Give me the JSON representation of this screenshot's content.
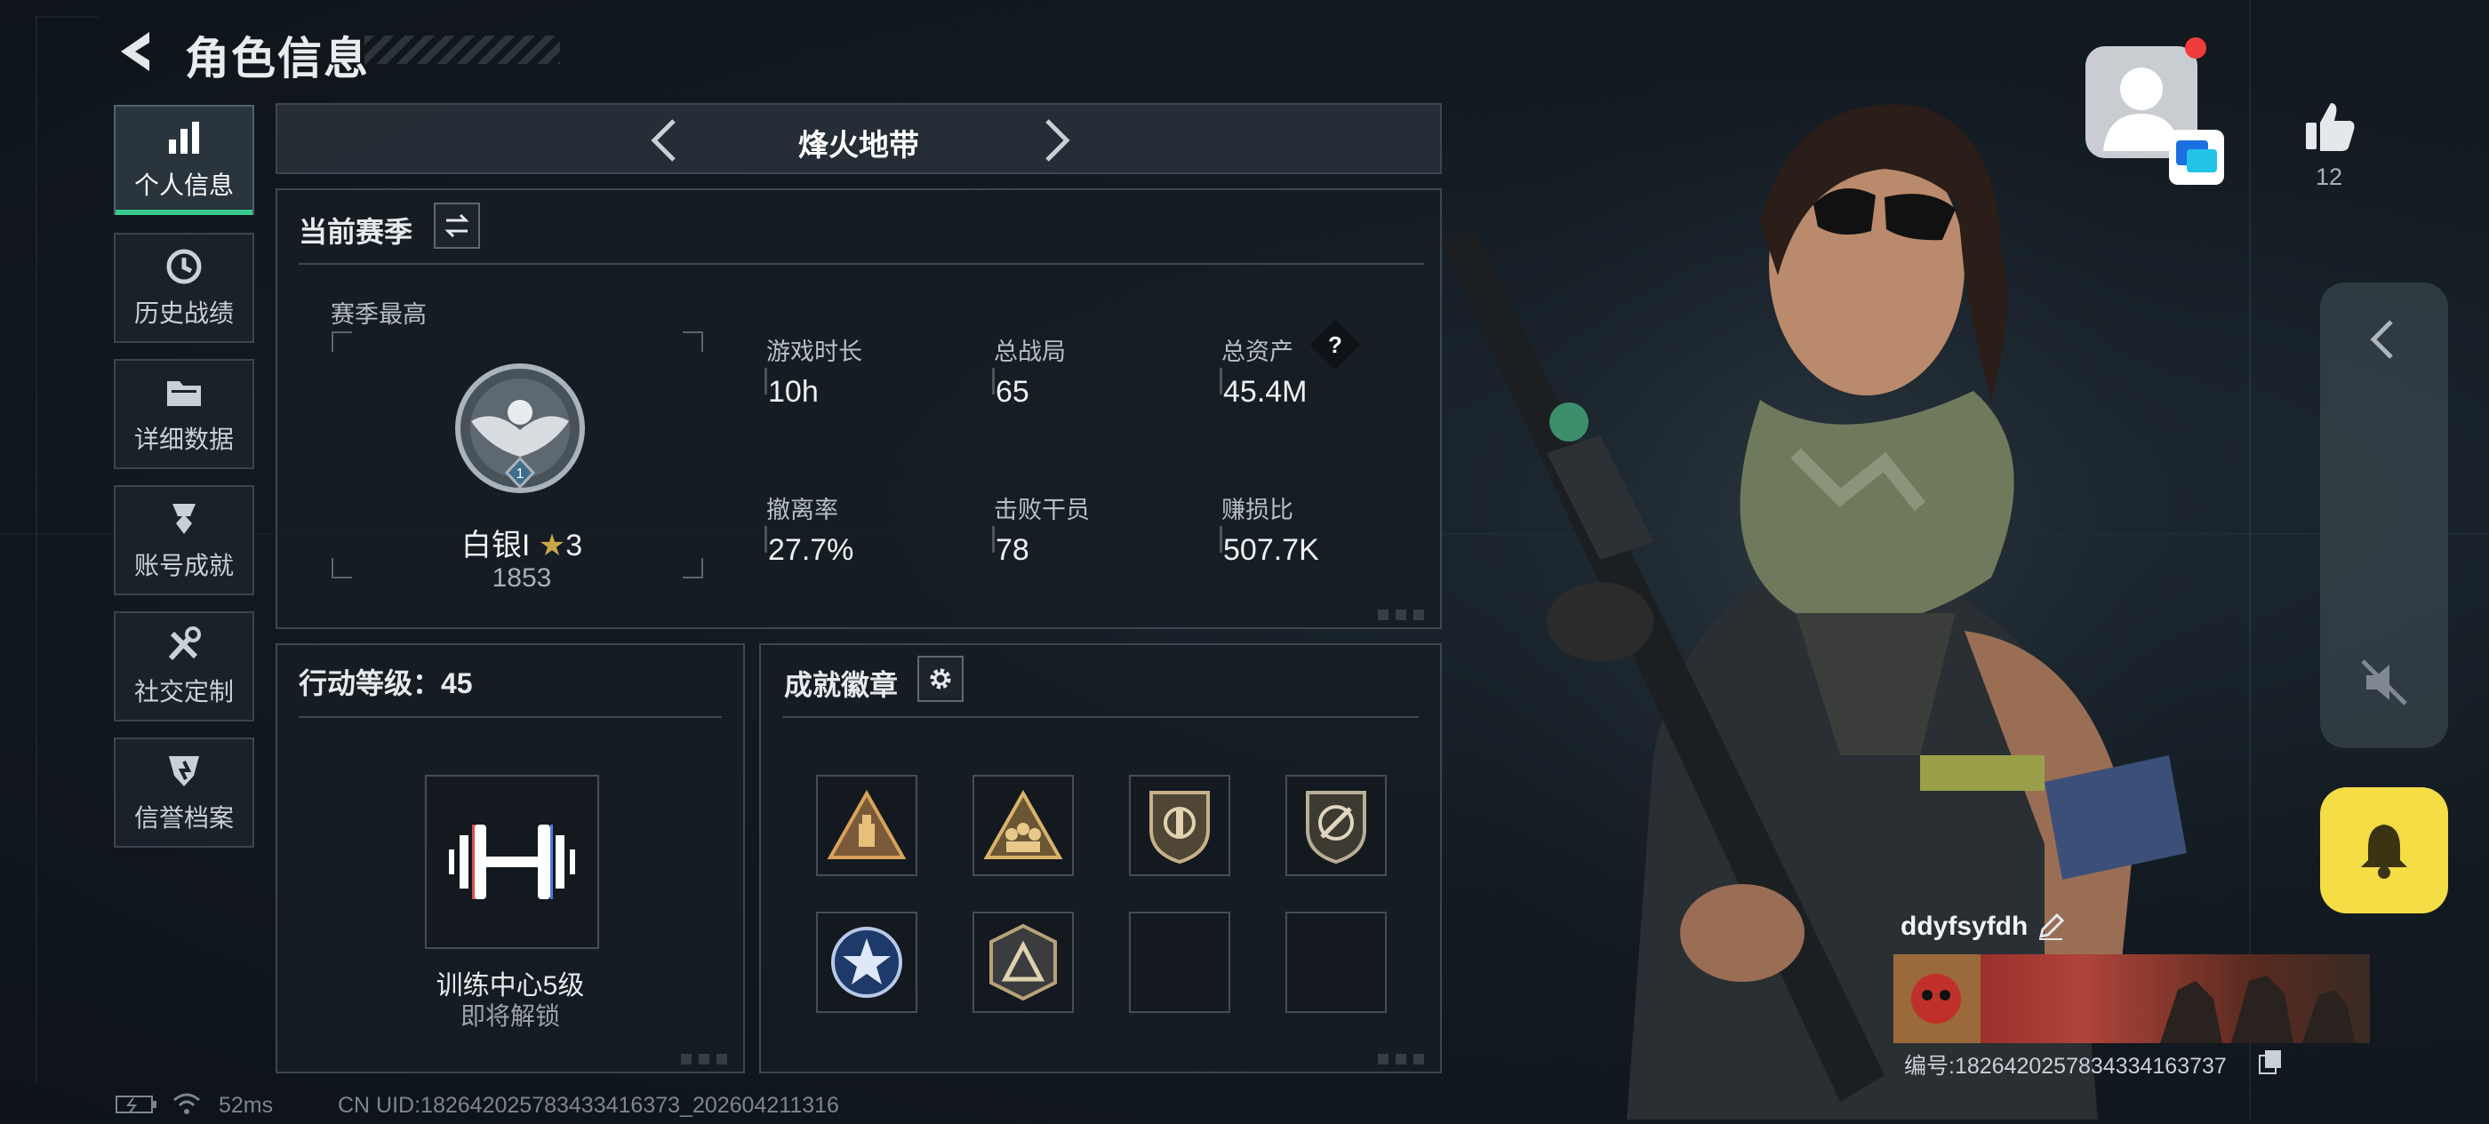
{
  "header": {
    "title": "角色信息"
  },
  "sidebar": {
    "items": [
      {
        "label": "个人信息",
        "icon": "bar-chart-icon",
        "active": true
      },
      {
        "label": "历史战绩",
        "icon": "history-clock-icon"
      },
      {
        "label": "详细数据",
        "icon": "folder-icon"
      },
      {
        "label": "账号成就",
        "icon": "achievement-icon"
      },
      {
        "label": "社交定制",
        "icon": "tools-icon"
      },
      {
        "label": "信誉档案",
        "icon": "credit-shield-icon"
      }
    ]
  },
  "mode": {
    "title": "烽火地带"
  },
  "season": {
    "title": "当前赛季",
    "best_label": "赛季最高",
    "rank_name": "白银I",
    "rank_stars": "3",
    "rank_score": "1853",
    "rank_badge_number": "1",
    "stats": [
      {
        "label": "游戏时长",
        "value": "10h"
      },
      {
        "label": "总战局",
        "value": "65"
      },
      {
        "label": "总资产",
        "value": "45.4M",
        "help": "?"
      },
      {
        "label": "撤离率",
        "value": "27.7%"
      },
      {
        "label": "击败干员",
        "value": "78"
      },
      {
        "label": "赚损比",
        "value": "507.7K"
      }
    ]
  },
  "level": {
    "title": "行动等级：45",
    "facility_name": "训练中心5级",
    "facility_status": "即将解锁"
  },
  "badges": {
    "title": "成就徽章",
    "slots": [
      "warning-triangle-badge",
      "squad-triangle-badge",
      "shield-emblem-badge",
      "shield-crossed-badge",
      "star-medal-badge",
      "pyramid-shield-badge",
      "",
      ""
    ]
  },
  "profile": {
    "likes": "12",
    "username": "ddyfsyfdh",
    "id_text": "编号:1826420257834334163737"
  },
  "status_bar": {
    "ping": "52ms",
    "uid": "CN UID:1826420257834334163​73_202604211316"
  },
  "colors": {
    "accent_green": "#39c98b",
    "bell_yellow": "#f4dd45",
    "notify_red": "#f23b3b"
  }
}
